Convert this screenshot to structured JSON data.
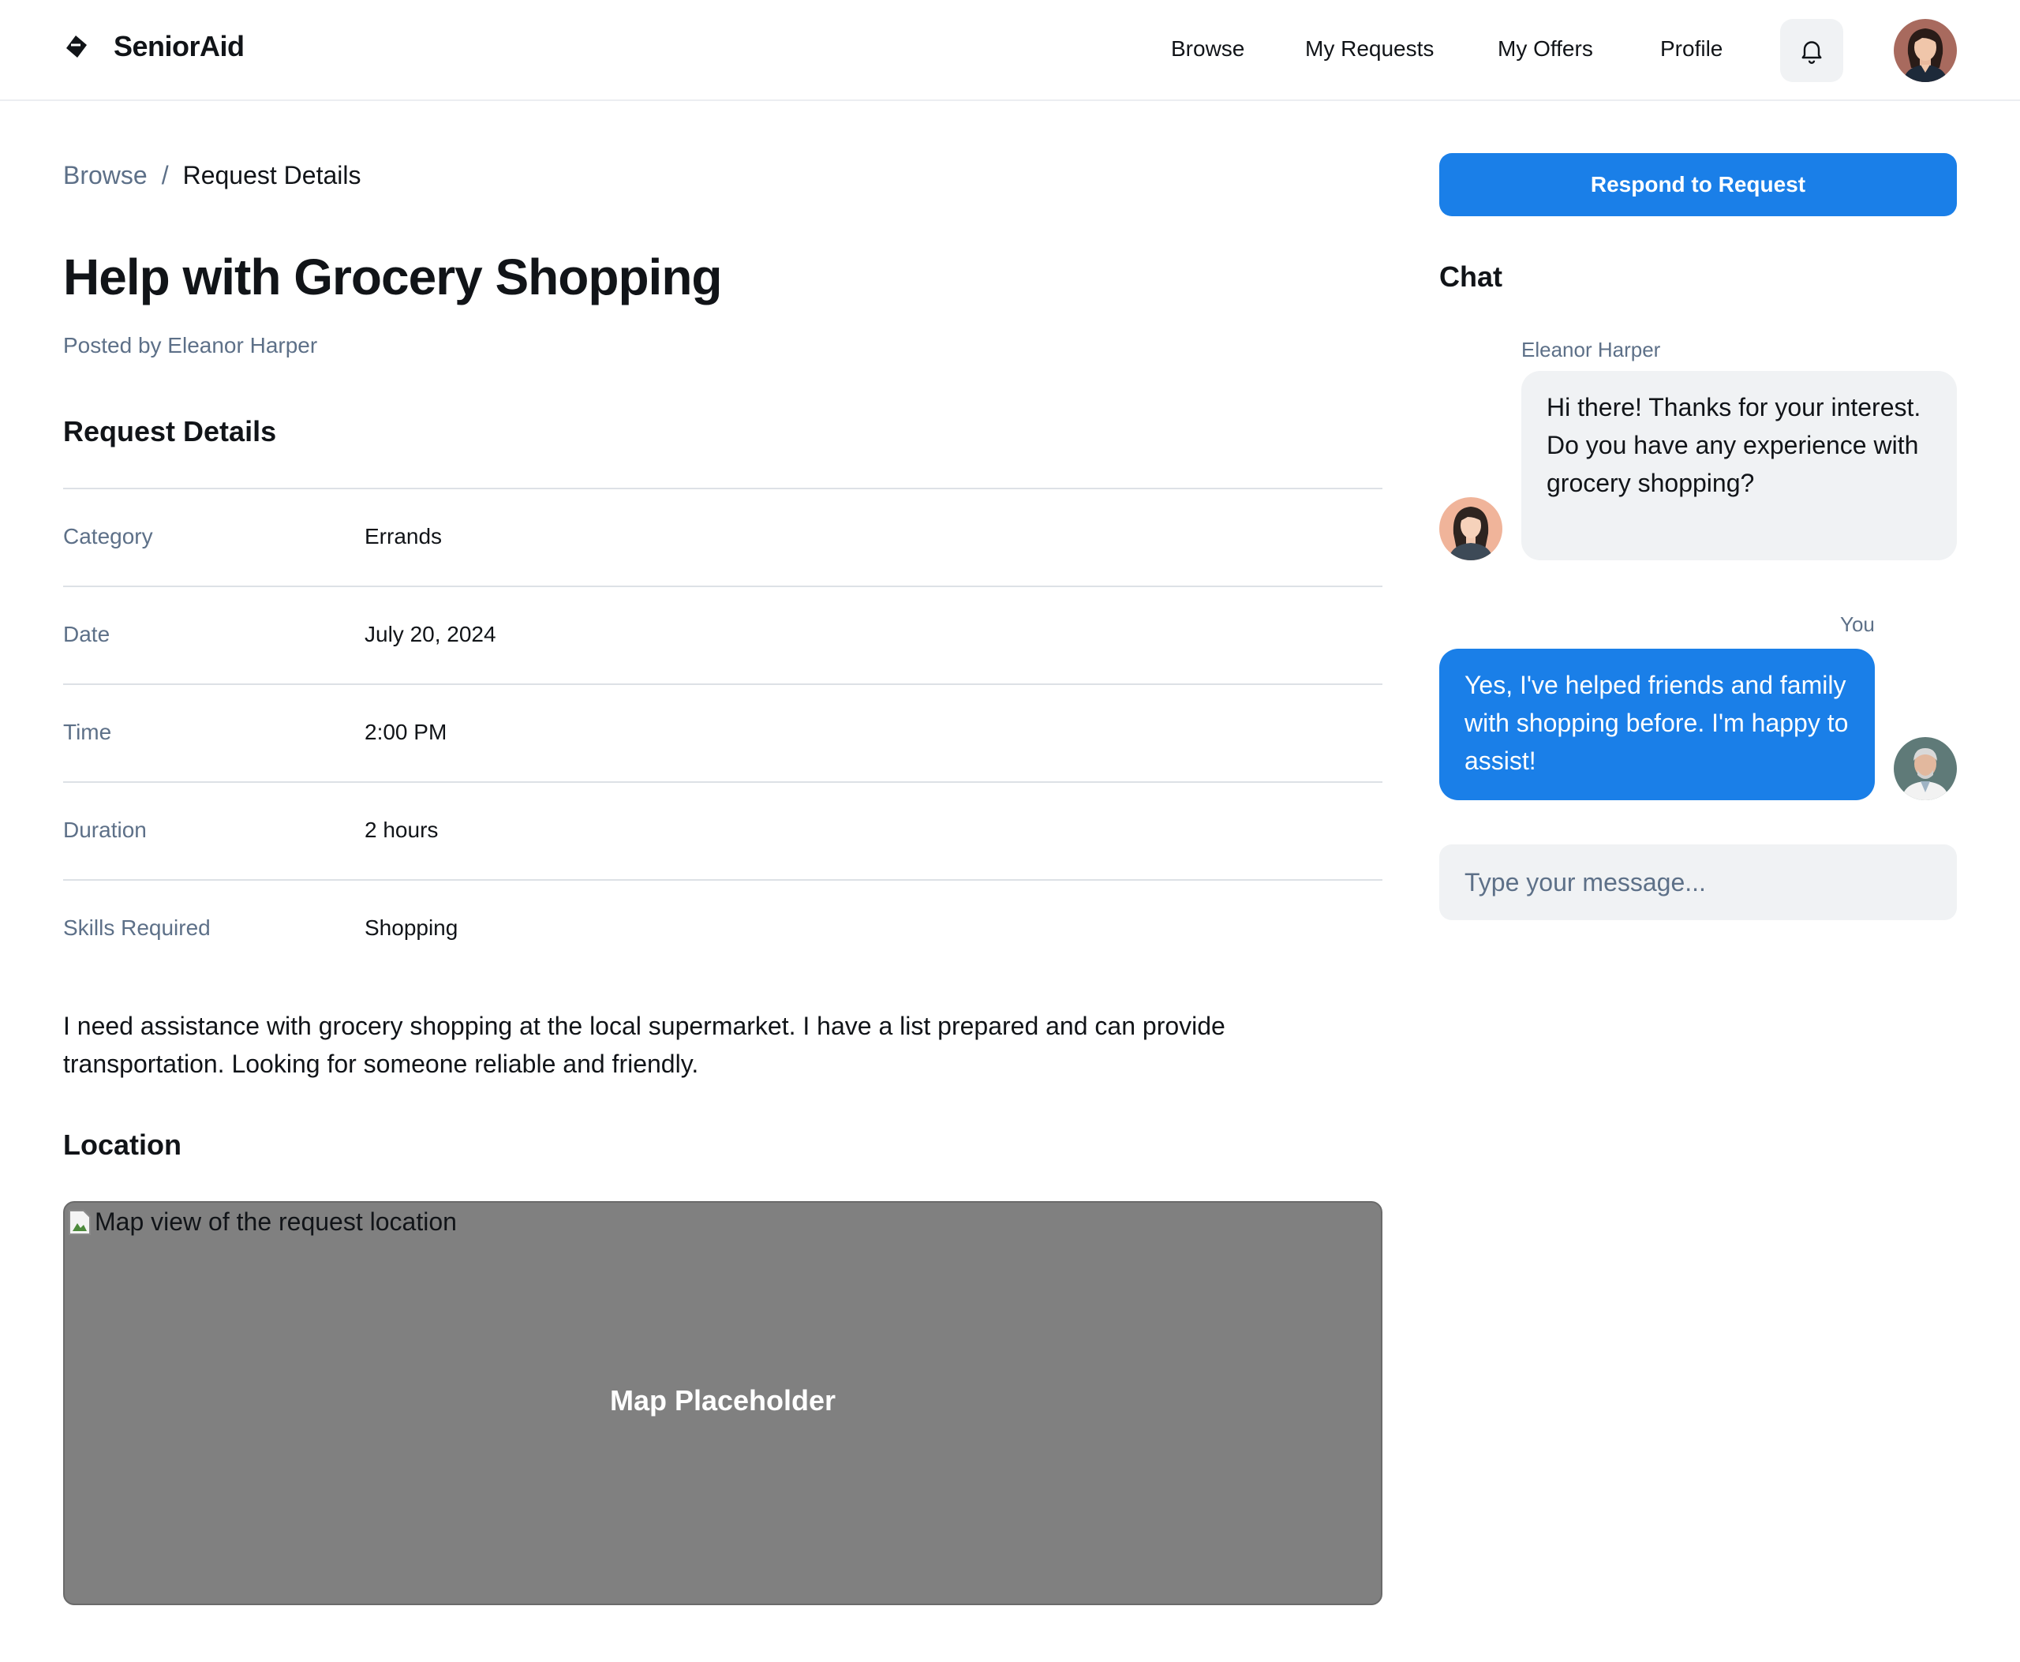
{
  "header": {
    "brand": "SeniorAid",
    "nav": [
      "Browse",
      "My Requests",
      "My Offers",
      "Profile"
    ]
  },
  "breadcrumb": {
    "parent": "Browse",
    "separator": "/",
    "current": "Request Details"
  },
  "request": {
    "title": "Help with Grocery Shopping",
    "posted_by": "Posted by Eleanor Harper",
    "details_heading": "Request Details",
    "details": [
      {
        "label": "Category",
        "value": "Errands"
      },
      {
        "label": "Date",
        "value": "July 20, 2024"
      },
      {
        "label": "Time",
        "value": "2:00 PM"
      },
      {
        "label": "Duration",
        "value": "2 hours"
      },
      {
        "label": "Skills Required",
        "value": "Shopping"
      }
    ],
    "description": "I need assistance with grocery shopping at the local supermarket. I have a list prepared and can provide transportation. Looking for someone reliable and friendly.",
    "location_heading": "Location",
    "map_alt": "Map view of the request location",
    "map_placeholder": "Map Placeholder"
  },
  "actions": {
    "respond": "Respond to Request"
  },
  "chat": {
    "title": "Chat",
    "messages": [
      {
        "sender": "Eleanor Harper",
        "text": "Hi there! Thanks for your interest. Do you have any experience with grocery shopping?"
      },
      {
        "sender": "You",
        "text": "Yes, I've helped friends and family with shopping before. I'm happy to assist!"
      }
    ],
    "input_placeholder": "Type your message..."
  },
  "colors": {
    "primary": "#1a7fe8",
    "muted_text": "#5d7088",
    "surface": "#f0f2f4",
    "map_background": "#808080"
  },
  "icons": [
    "brand-logo-icon",
    "bell-icon",
    "broken-image-icon"
  ]
}
